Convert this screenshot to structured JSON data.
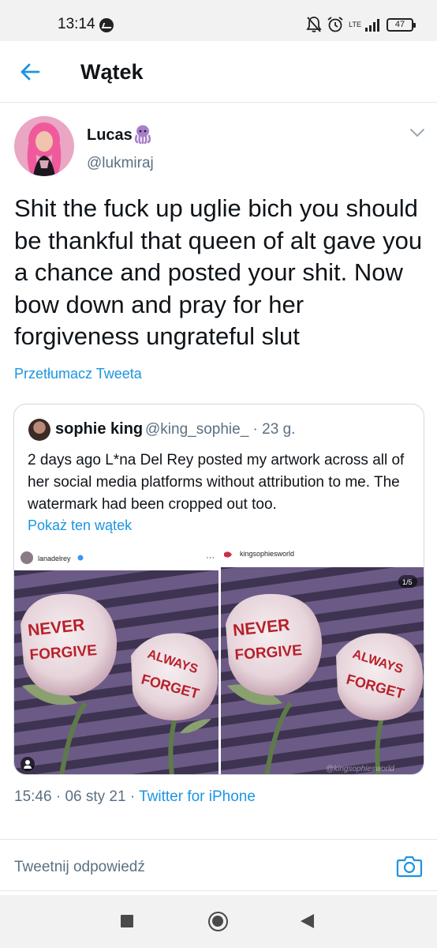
{
  "status_bar": {
    "time": "13:14",
    "network": "LTE",
    "battery": "47",
    "icons": [
      "messenger-icon",
      "bell-off-icon",
      "alarm-icon",
      "signal-icon",
      "battery-icon"
    ]
  },
  "header": {
    "title": "Wątek",
    "back_icon": "arrow-left-icon"
  },
  "tweet": {
    "author_name": "Lucas",
    "author_emoji": "octopus-emoji",
    "handle": "@lukmiraj",
    "text": "Shit the fuck up uglie bich you should be thankful that queen of alt gave you a chance and posted your shit. Now bow down and pray for her forgiveness ungrateful slut",
    "translate_label": "Przetłumacz Tweeta",
    "time": "15:46",
    "date": "06 sty 21",
    "source": "Twitter for iPhone"
  },
  "quoted_tweet": {
    "author_name": "sophie king",
    "handle_and_time": "@king_sophie_ · 23 g.",
    "text": "2 days ago L*na Del Rey posted my artwork across all of her social media platforms without attribution to me. The watermark had been cropped out too.",
    "thread_link": "Pokaż ten wątek",
    "media": {
      "left_account": "lanadelrey",
      "right_account": "kingsophiesworld",
      "counter": "1/5",
      "watermark": "@kingsophiesworld",
      "rose_1_text": [
        "NEVER",
        "FORGIVE"
      ],
      "rose_2_text": [
        "ALWAYS",
        "FORGET"
      ]
    }
  },
  "reply": {
    "placeholder": "Tweetnij odpowiedź",
    "camera_icon": "camera-icon"
  },
  "colors": {
    "accent": "#1b95e0",
    "secondary_text": "#5b7083",
    "divider": "#e1e8ed"
  }
}
